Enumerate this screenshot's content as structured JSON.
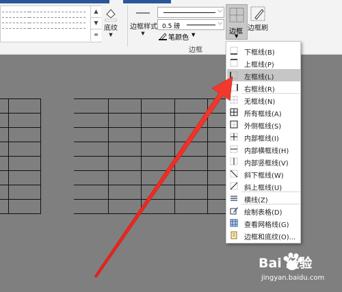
{
  "ribbon": {
    "shading_label": "底纹",
    "border_styles_label": "边框样式",
    "pen_weight": "0.5 磅",
    "pen_color_label": "笔颜色",
    "border_label": "边框",
    "border_painter_label": "边框刷",
    "group_label": "边框"
  },
  "menu": {
    "items": [
      {
        "label": "下框线(B)",
        "icon": "bottom-border-icon"
      },
      {
        "label": "上框线(P)",
        "icon": "top-border-icon"
      },
      {
        "label": "左框线(L)",
        "icon": "left-border-icon",
        "highlighted": true
      },
      {
        "label": "右框线(R)",
        "icon": "right-border-icon"
      },
      {
        "label": "无框线(N)",
        "icon": "no-border-icon"
      },
      {
        "label": "所有框线(A)",
        "icon": "all-borders-icon"
      },
      {
        "label": "外侧框线(S)",
        "icon": "outside-borders-icon"
      },
      {
        "label": "内部框线(I)",
        "icon": "inside-borders-icon"
      },
      {
        "label": "内部横框线(H)",
        "icon": "inside-horizontal-border-icon"
      },
      {
        "label": "内部竖框线(V)",
        "icon": "inside-vertical-border-icon"
      },
      {
        "label": "斜下框线(W)",
        "icon": "diagonal-down-border-icon"
      },
      {
        "label": "斜上框线(U)",
        "icon": "diagonal-up-border-icon"
      },
      {
        "label": "横线(Z)",
        "icon": "horizontal-line-icon"
      },
      {
        "label": "绘制表格(D)",
        "icon": "draw-table-icon"
      },
      {
        "label": "查看网格线(G)",
        "icon": "view-gridlines-icon"
      },
      {
        "label": "边框和底纹(O)...",
        "icon": "borders-shading-icon"
      }
    ]
  },
  "watermark": {
    "logo": "Bai 经验",
    "url": "jingyan.baidu.com"
  },
  "colors": {
    "ribbon_bg": "#f3f3f3",
    "doc_bg": "#7f7f7f",
    "accent": "#2b579a",
    "arrow": "#e8201a",
    "menu_hover": "#c6c6c6"
  }
}
